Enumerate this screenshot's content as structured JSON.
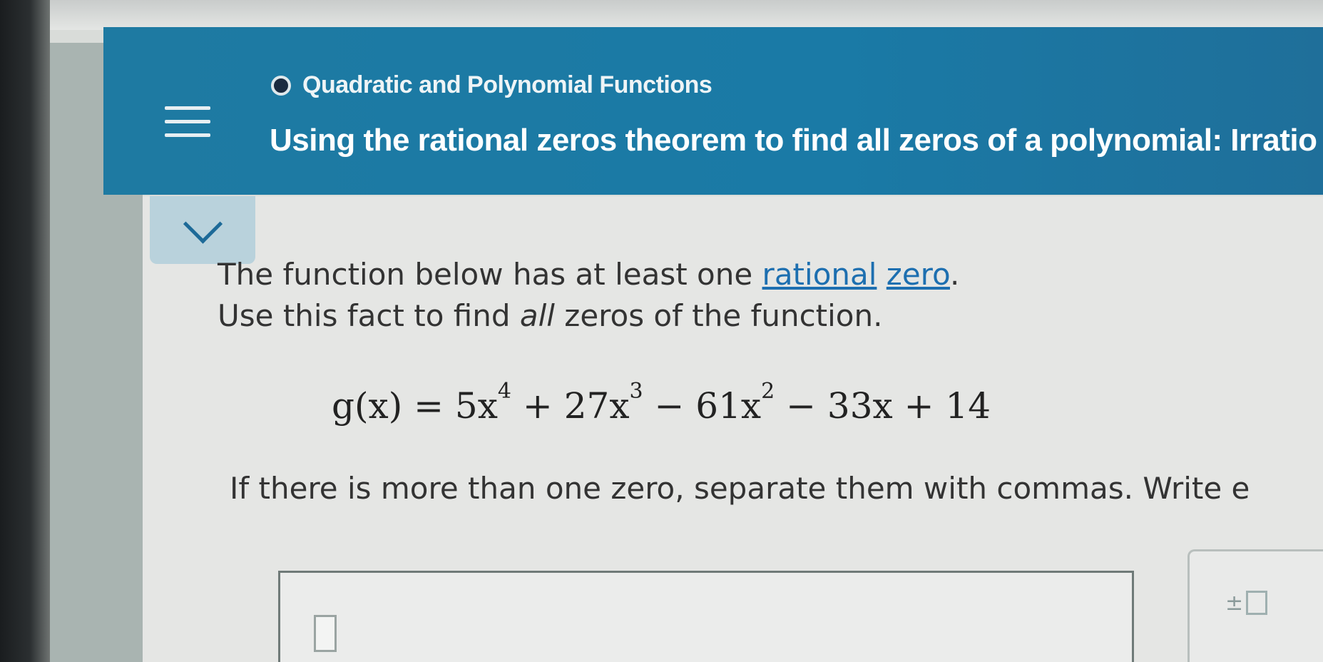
{
  "header": {
    "course": "Quadratic and Polynomial Functions",
    "topic": "Using the rational zeros theorem to find all zeros of a polynomial: Irratio"
  },
  "icons": {
    "menu": "hamburger-menu-icon",
    "course": "circle-dot-icon",
    "expand": "chevron-down-icon",
    "plus_minus": "plus-minus-box-icon"
  },
  "question": {
    "line1_prefix": "The function below has at least one ",
    "link1": "rational",
    "link2": "zero",
    "line1_suffix": ".",
    "line2_prefix": "Use this fact to find ",
    "line2_emph": "all",
    "line2_suffix": " zeros of the function.",
    "formula": {
      "lhs": "g(x) = 5x",
      "exp1": "4",
      "t2": " + 27x",
      "exp2": "3",
      "t3": " − 61x",
      "exp3": "2",
      "t4": " − 33x + 14"
    },
    "instruction": "If there is more than one zero, separate them with commas. Write e"
  },
  "answer": {
    "value": ""
  },
  "toolbar": {
    "plus_minus_label": "±"
  },
  "colors": {
    "header_bg": "#1e7aa2",
    "link": "#1d6fb0",
    "text": "#333333"
  }
}
